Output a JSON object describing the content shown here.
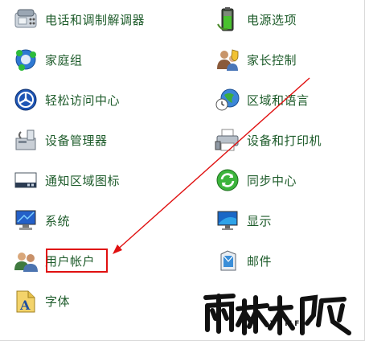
{
  "items": {
    "phone_modem": "电话和调制解调器",
    "power_options": "电源选项",
    "homegroup": "家庭组",
    "parental_controls": "家长控制",
    "ease_of_access": "轻松访问中心",
    "region_language": "区域和语言",
    "device_manager": "设备管理器",
    "devices_printers": "设备和打印机",
    "notification_icons": "通知区域图标",
    "sync_center": "同步中心",
    "system": "系统",
    "display": "显示",
    "user_accounts": "用户帐户",
    "mail": "邮件",
    "fonts": "字体"
  },
  "watermark": {
    "logo_text": "雨林木风",
    "sub_text": "YLMF"
  },
  "colors": {
    "link_text": "#1e5c2b",
    "highlight_box": "#e01010",
    "arrow": "#e01010"
  }
}
